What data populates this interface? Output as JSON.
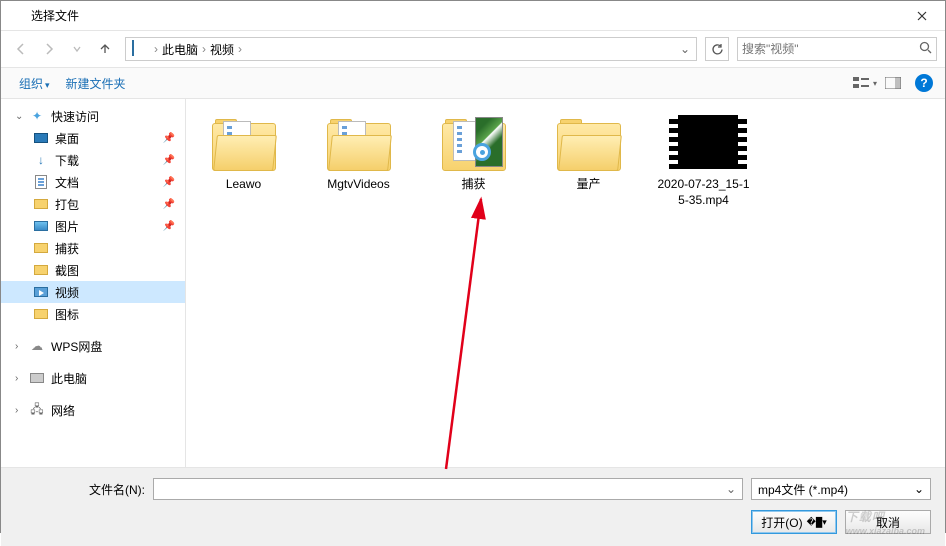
{
  "window": {
    "title": "选择文件"
  },
  "breadcrumb": {
    "root": "此电脑",
    "current": "视频"
  },
  "search": {
    "placeholder": "搜索\"视频\""
  },
  "toolbar": {
    "organize": "组织",
    "new_folder": "新建文件夹"
  },
  "sidebar": {
    "quick_access": "快速访问",
    "items": {
      "desktop": "桌面",
      "downloads": "下载",
      "documents": "文档",
      "dabao": "打包",
      "pictures": "图片",
      "capture": "捕获",
      "screenshot": "截图",
      "video": "视频",
      "icons": "图标"
    },
    "wps": "WPS网盘",
    "this_pc": "此电脑",
    "network": "网络"
  },
  "files": {
    "leawo": "Leawo",
    "mgtv": "MgtvVideos",
    "capture": "捕获",
    "liangchan": "量产",
    "video1": "2020-07-23_15-15-35.mp4"
  },
  "footer": {
    "filename_label": "文件名(N):",
    "filter": "mp4文件 (*.mp4)",
    "open": "打开(O)",
    "cancel": "取消"
  },
  "watermark": {
    "main": "下载吧",
    "sub": "www.xiazaiba.com"
  }
}
